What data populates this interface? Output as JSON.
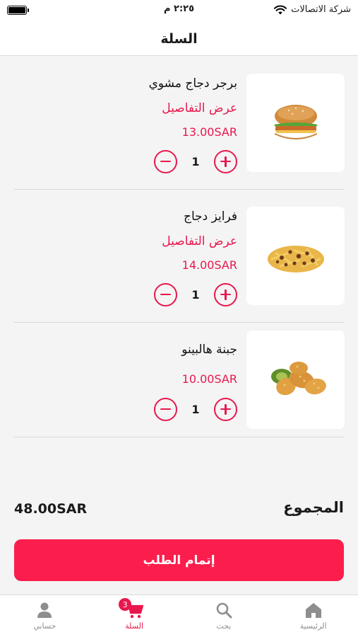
{
  "status_bar": {
    "carrier": "شركة الاتصالات",
    "time": "٢:٢٥ م"
  },
  "header": {
    "title": "السلة"
  },
  "cart": {
    "items": [
      {
        "name": "برجر دجاج مشوي",
        "details_label": "عرض التفاصيل",
        "price": "13.00SAR",
        "quantity": "1",
        "image_icon": "burger-image"
      },
      {
        "name": "فرايز دجاج",
        "details_label": "عرض التفاصيل",
        "price": "14.00SAR",
        "quantity": "1",
        "image_icon": "fries-image"
      },
      {
        "name": "جبنة هالبينو",
        "price": "10.00SAR",
        "quantity": "1",
        "image_icon": "jalapeno-poppers-image"
      }
    ]
  },
  "summary": {
    "total_label": "المجموع",
    "total_value": "48.00SAR"
  },
  "checkout": {
    "label": "إتمام الطلب"
  },
  "tabbar": {
    "tabs": [
      {
        "label": "الرئيسية",
        "icon": "home-icon"
      },
      {
        "label": "بحث",
        "icon": "search-icon"
      },
      {
        "label": "السلة",
        "icon": "cart-icon",
        "badge": "3",
        "active": true
      },
      {
        "label": "حسابي",
        "icon": "user-icon"
      }
    ]
  },
  "colors": {
    "accent": "#e8174d",
    "button": "#fb1e4d",
    "background": "#f4f4f4",
    "inactive_tab": "#8e8e8e"
  }
}
